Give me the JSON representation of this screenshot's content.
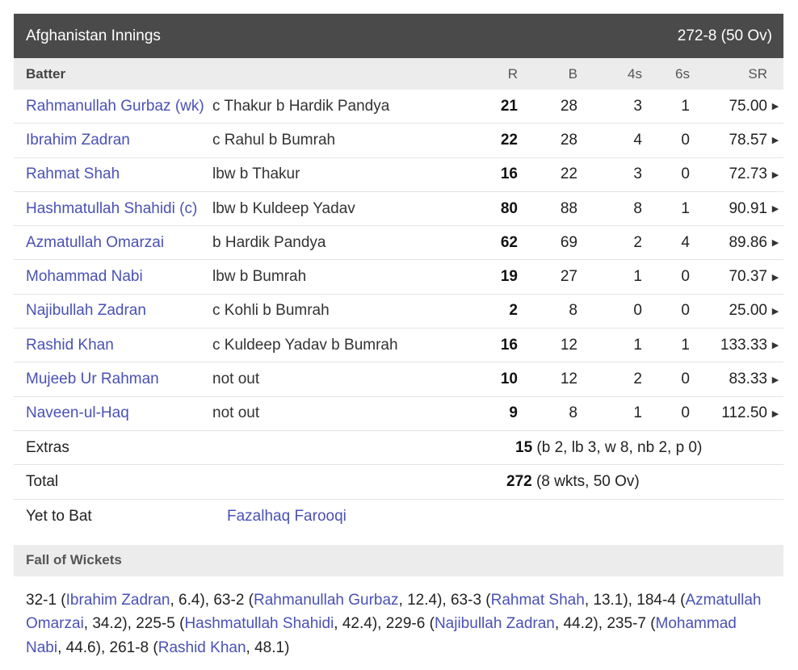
{
  "innings": {
    "title": "Afghanistan Innings",
    "score": "272-8 (50 Ov)"
  },
  "columns": {
    "batter": "Batter",
    "r": "R",
    "b": "B",
    "fours": "4s",
    "sixes": "6s",
    "sr": "SR"
  },
  "batters": [
    {
      "name": "Rahmanullah Gurbaz (wk)",
      "dismissal": "c Thakur b Hardik Pandya",
      "r": "21",
      "b": "28",
      "fours": "3",
      "sixes": "1",
      "sr": "75.00"
    },
    {
      "name": "Ibrahim Zadran",
      "dismissal": "c Rahul b Bumrah",
      "r": "22",
      "b": "28",
      "fours": "4",
      "sixes": "0",
      "sr": "78.57"
    },
    {
      "name": "Rahmat Shah",
      "dismissal": "lbw b Thakur",
      "r": "16",
      "b": "22",
      "fours": "3",
      "sixes": "0",
      "sr": "72.73"
    },
    {
      "name": "Hashmatullah Shahidi (c)",
      "dismissal": "lbw b Kuldeep Yadav",
      "r": "80",
      "b": "88",
      "fours": "8",
      "sixes": "1",
      "sr": "90.91"
    },
    {
      "name": "Azmatullah Omarzai",
      "dismissal": "b Hardik Pandya",
      "r": "62",
      "b": "69",
      "fours": "2",
      "sixes": "4",
      "sr": "89.86"
    },
    {
      "name": "Mohammad Nabi",
      "dismissal": "lbw b Bumrah",
      "r": "19",
      "b": "27",
      "fours": "1",
      "sixes": "0",
      "sr": "70.37"
    },
    {
      "name": "Najibullah Zadran",
      "dismissal": "c Kohli b Bumrah",
      "r": "2",
      "b": "8",
      "fours": "0",
      "sixes": "0",
      "sr": "25.00"
    },
    {
      "name": "Rashid Khan",
      "dismissal": "c Kuldeep Yadav b Bumrah",
      "r": "16",
      "b": "12",
      "fours": "1",
      "sixes": "1",
      "sr": "133.33"
    },
    {
      "name": "Mujeeb Ur Rahman",
      "dismissal": "not out",
      "r": "10",
      "b": "12",
      "fours": "2",
      "sixes": "0",
      "sr": "83.33"
    },
    {
      "name": "Naveen-ul-Haq",
      "dismissal": "not out",
      "r": "9",
      "b": "8",
      "fours": "1",
      "sixes": "0",
      "sr": "112.50"
    }
  ],
  "extras": {
    "label": "Extras",
    "total": "15",
    "detail": " (b 2, lb 3, w 8, nb 2, p 0)"
  },
  "total": {
    "label": "Total",
    "runs": "272",
    "detail": " (8 wkts, 50 Ov)"
  },
  "yet_to_bat": {
    "label": "Yet to Bat",
    "players": "Fazalhaq Farooqi"
  },
  "fall_of_wickets": {
    "title": "Fall of Wickets",
    "items": [
      {
        "score": "32-1",
        "name": "Ibrahim Zadran",
        "over": "6.4"
      },
      {
        "score": "63-2",
        "name": "Rahmanullah Gurbaz",
        "over": "12.4"
      },
      {
        "score": "63-3",
        "name": "Rahmat Shah",
        "over": "13.1"
      },
      {
        "score": "184-4",
        "name": "Azmatullah Omarzai",
        "over": "34.2"
      },
      {
        "score": "225-5",
        "name": "Hashmatullah Shahidi",
        "over": "42.4"
      },
      {
        "score": "229-6",
        "name": "Najibullah Zadran",
        "over": "44.2"
      },
      {
        "score": "235-7",
        "name": "Mohammad Nabi",
        "over": "44.6"
      },
      {
        "score": "261-8",
        "name": "Rashid Khan",
        "over": "48.1"
      }
    ]
  },
  "icons": {
    "expand_arrow": "triangle-right-icon"
  }
}
